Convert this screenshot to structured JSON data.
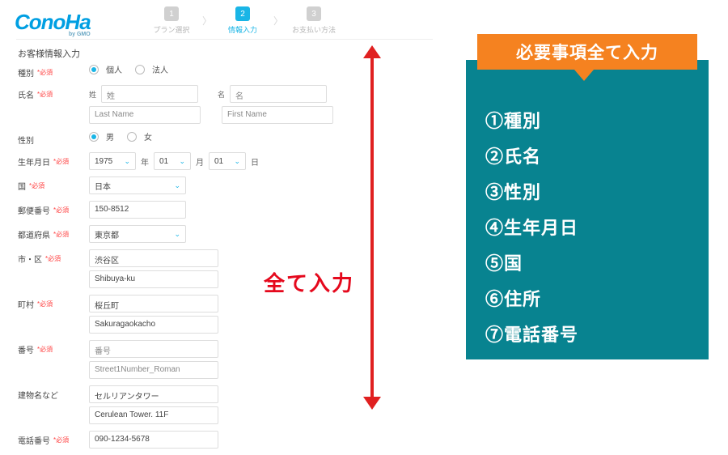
{
  "brand": {
    "name": "ConoHa",
    "tag": "by GMO"
  },
  "stepper": {
    "step1": {
      "num": "1",
      "label": "プラン選択"
    },
    "step2": {
      "num": "2",
      "label": "情報入力"
    },
    "step3": {
      "num": "3",
      "label": "お支払い方法"
    }
  },
  "section_title": "お客様情報入力",
  "rows": {
    "type": {
      "label": "種別",
      "opt1": "個人",
      "opt2": "法人"
    },
    "name": {
      "label": "氏名",
      "sei_h": "姓",
      "mei_h": "名",
      "sei_v": "姓",
      "mei_v": "名",
      "last_ph": "Last Name",
      "first_ph": "First Name"
    },
    "gender": {
      "label": "性別",
      "opt1": "男",
      "opt2": "女"
    },
    "dob": {
      "label": "生年月日",
      "year": "1975",
      "month": "01",
      "day": "01",
      "y_unit": "年",
      "m_unit": "月",
      "d_unit": "日"
    },
    "country": {
      "label": "国",
      "value": "日本"
    },
    "postal": {
      "label": "郵便番号",
      "value": "150-8512"
    },
    "pref": {
      "label": "都道府県",
      "value": "東京都"
    },
    "city": {
      "label": "市・区",
      "jp": "渋谷区",
      "en": "Shibuya-ku"
    },
    "town": {
      "label": "町村",
      "jp": "桜丘町",
      "en": "Sakuragaokacho"
    },
    "street": {
      "label": "番号",
      "jp": "番号",
      "en": "Street1Number_Roman"
    },
    "building": {
      "label": "建物名など",
      "jp": "セルリアンタワー",
      "en": "Cerulean Tower. 11F"
    },
    "phone": {
      "label": "電話番号",
      "value": "090-1234-5678"
    }
  },
  "required": "*必須",
  "arrow_caption": "全て入力",
  "banner": "必要事項全て入力",
  "checklist": {
    "i1": "①種別",
    "i2": "②氏名",
    "i3": "③性別",
    "i4": "④生年月日",
    "i5": "⑤国",
    "i6": "⑥住所",
    "i7": "⑦電話番号"
  }
}
